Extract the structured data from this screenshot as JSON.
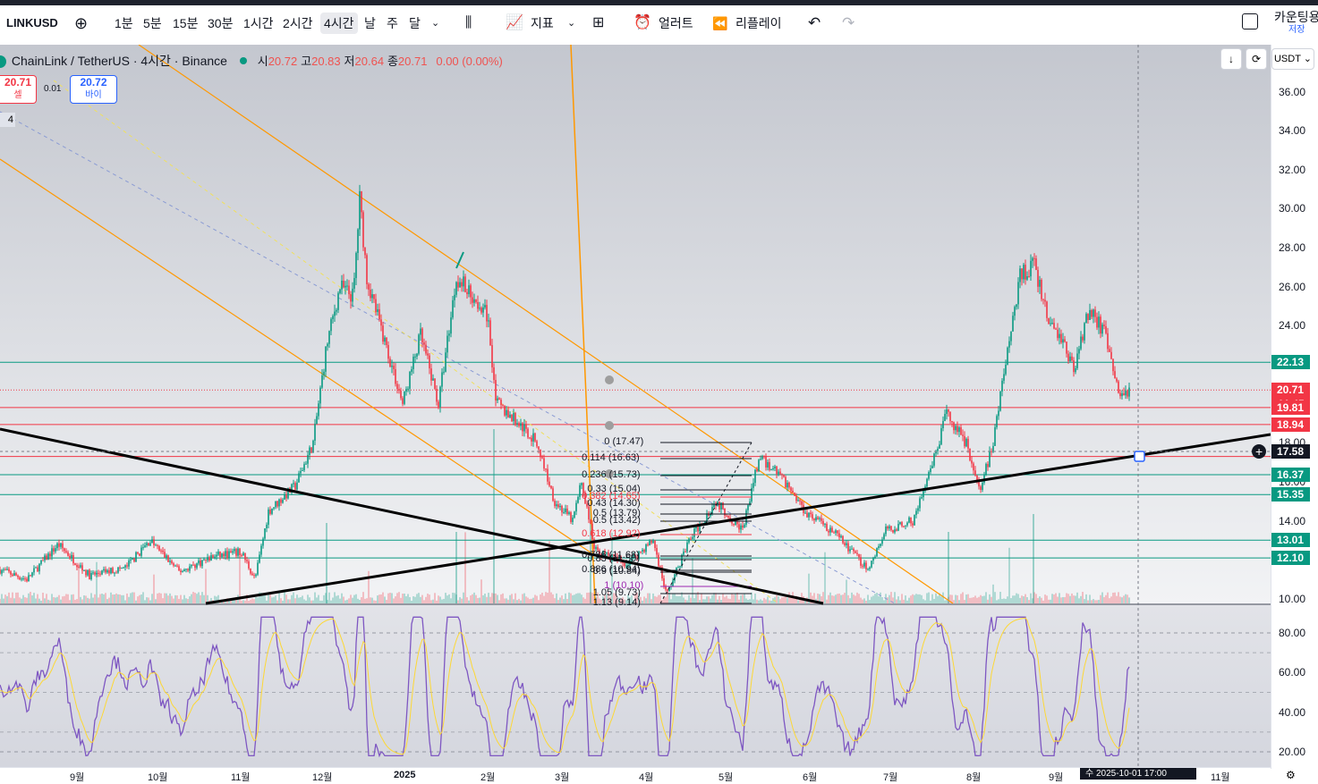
{
  "toolbar": {
    "symbol": "LINKUSD",
    "intervals": [
      "1분",
      "5분",
      "15분",
      "30분",
      "1시간",
      "2시간",
      "4시간",
      "날",
      "주",
      "달"
    ],
    "selected_interval": "4시간",
    "indicators_label": "지표",
    "alert_label": "얼러트",
    "replay_label": "리플레이",
    "countdown_label": "카운팅용",
    "save_label": "저장"
  },
  "legend": {
    "title": "ChainLink / TetherUS · 4시간 · Binance",
    "open_label": "시",
    "open": "20.72",
    "high_label": "고",
    "high": "20.83",
    "low_label": "저",
    "low": "20.64",
    "close_label": "종",
    "close": "20.71",
    "change": "0.00 (0.00%)"
  },
  "trade": {
    "sell_price": "20.71",
    "sell_label": "셀",
    "spread": "0.01",
    "buy_price": "20.72",
    "buy_label": "바이",
    "layer_count": "4"
  },
  "currency": "USDT",
  "price_axis": [
    "36.00",
    "34.00",
    "32.00",
    "30.00",
    "28.00",
    "26.00",
    "24.00",
    "22.00",
    "20.00",
    "18.00",
    "16.00",
    "14.00",
    "12.00",
    "10.00"
  ],
  "price_badges": [
    {
      "value": "22.13",
      "color": "#089981"
    },
    {
      "value": "20.71",
      "color": "#f23645"
    },
    {
      "value": "44:45",
      "color": "#f23645"
    },
    {
      "value": "19.81",
      "color": "#f23645"
    },
    {
      "value": "18.94",
      "color": "#f23645"
    },
    {
      "value": "17.58",
      "color": "#131722"
    },
    {
      "value": "16.37",
      "color": "#089981"
    },
    {
      "value": "15.35",
      "color": "#089981"
    },
    {
      "value": "13.01",
      "color": "#089981"
    },
    {
      "value": "12.10",
      "color": "#089981"
    }
  ],
  "rsi_axis": [
    "80.00",
    "60.00",
    "40.00",
    "20.00"
  ],
  "time_axis": [
    "9월",
    "10월",
    "11월",
    "12월",
    "2025",
    "2월",
    "3월",
    "4월",
    "5월",
    "6월",
    "7월",
    "8월",
    "9월",
    "10월",
    "11월"
  ],
  "crosshair_time": "수 2025-10-01  17:00",
  "fib_levels": [
    {
      "label": "0 (17.47)",
      "color": "#131722"
    },
    {
      "label": "0.114 (16.63)",
      "color": "#131722"
    },
    {
      "label": "0.236 (15.73)",
      "color": "#131722"
    },
    {
      "label": "0.33 (15.04)",
      "color": "#131722"
    },
    {
      "label": "0.382 (14.65)",
      "color": "#f23645"
    },
    {
      "label": "0.43 (14.30)",
      "color": "#131722"
    },
    {
      "label": "0.5 (13.79)",
      "color": "#131722"
    },
    {
      "label": "0.5 (13.42)",
      "color": "#131722"
    },
    {
      "label": "0.618 (12.92)",
      "color": "#f23645"
    },
    {
      "label": "0.786 (11.68)",
      "color": "#131722"
    },
    {
      "label": "0.83 (11.50)",
      "color": "#131722"
    },
    {
      "label": "0.886 (10.94)",
      "color": "#131722"
    },
    {
      "label": "0.9 (10.84)",
      "color": "#131722"
    },
    {
      "label": "1 (10.10)",
      "color": "#9c27b0"
    },
    {
      "label": "1.05 (9.73)",
      "color": "#131722"
    },
    {
      "label": "1.13 (9.14)",
      "color": "#131722"
    }
  ],
  "colors": {
    "up": "#089981",
    "down": "#f23645",
    "rsi": "#7e57c2",
    "rsi_ma": "#fdd835",
    "fib_channel": "#ff9800"
  }
}
